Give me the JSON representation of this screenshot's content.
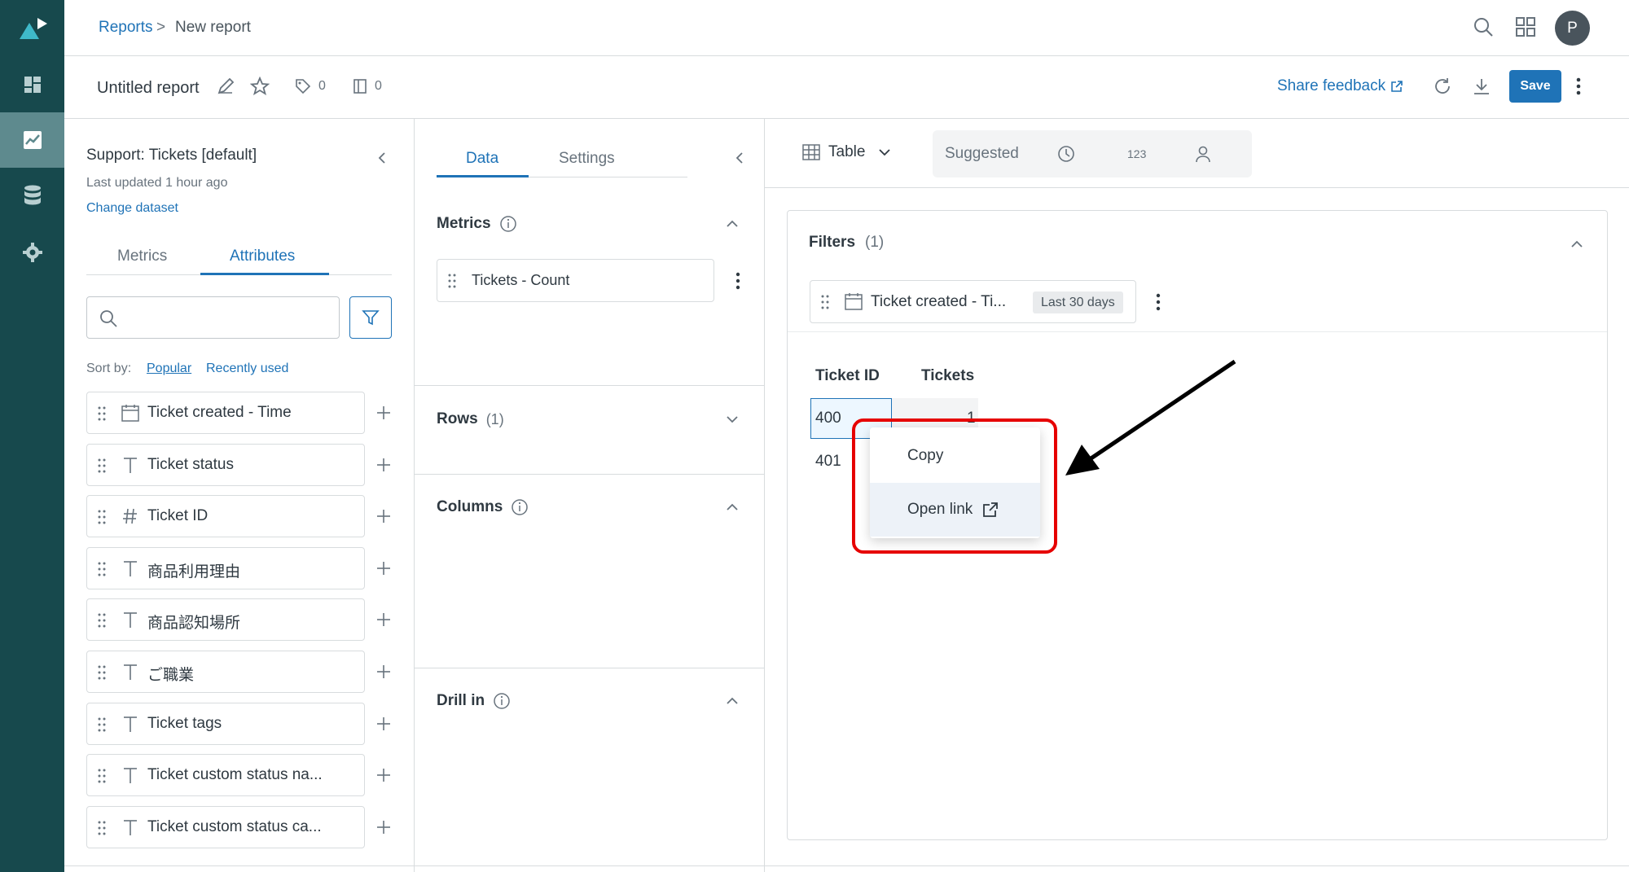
{
  "breadcrumb": {
    "parent": "Reports",
    "separator": ">",
    "current": "New report"
  },
  "header": {
    "avatar_initial": "P"
  },
  "report": {
    "title": "Untitled report",
    "tags_count": "0",
    "sheets_count": "0",
    "share_feedback": "Share feedback",
    "save_label": "Save"
  },
  "dataset": {
    "name": "Support: Tickets [default]",
    "updated": "Last updated 1 hour ago",
    "change": "Change dataset",
    "tabs": [
      "Metrics",
      "Attributes"
    ],
    "sort_label": "Sort by:",
    "sort_popular": "Popular",
    "sort_recent": "Recently used",
    "attributes": [
      {
        "label": "Ticket created - Time",
        "icon": "calendar-icon"
      },
      {
        "label": "Ticket status",
        "icon": "text-type-icon"
      },
      {
        "label": "Ticket ID",
        "icon": "hash-icon"
      },
      {
        "label": "商品利用理由",
        "icon": "text-type-icon"
      },
      {
        "label": "商品認知場所",
        "icon": "text-type-icon"
      },
      {
        "label": "ご職業",
        "icon": "text-type-icon"
      },
      {
        "label": "Ticket tags",
        "icon": "text-type-icon"
      },
      {
        "label": "Ticket custom status na...",
        "icon": "text-type-icon"
      },
      {
        "label": "Ticket custom status ca...",
        "icon": "text-type-icon"
      }
    ]
  },
  "config": {
    "tabs": [
      "Data",
      "Settings"
    ],
    "metrics_title": "Metrics",
    "metric_item": "Tickets - Count",
    "rows_title": "Rows",
    "rows_count": "(1)",
    "columns_title": "Columns",
    "drill_title": "Drill in"
  },
  "viz": {
    "type_label": "Table",
    "suggested_label": "Suggested",
    "numeric_label": "123"
  },
  "results": {
    "filters_title": "Filters",
    "filters_count": "(1)",
    "filter_label": "Ticket created - Ti...",
    "filter_badge": "Last 30 days",
    "columns": [
      "Ticket ID",
      "Tickets"
    ],
    "rows": [
      {
        "id": "400",
        "tickets": "1"
      },
      {
        "id": "401",
        "tickets": ""
      }
    ]
  },
  "context_menu": {
    "copy": "Copy",
    "open_link": "Open link"
  },
  "colors": {
    "rail": "#17494d",
    "accent": "#1f73b7",
    "highlight": "#e60000"
  }
}
